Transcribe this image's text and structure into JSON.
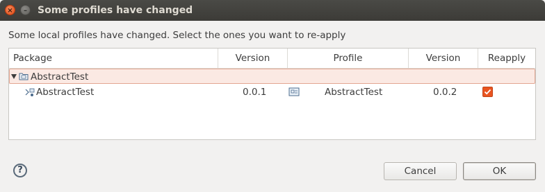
{
  "window": {
    "title": "Some profiles have changed",
    "close_glyph": "×",
    "min_glyph": "–"
  },
  "message": "Some local profiles have changed. Select the ones you want to re-apply",
  "table": {
    "columns": [
      "Package",
      "Version",
      "Profile",
      "Version",
      "Reapply"
    ],
    "group": {
      "label": "AbstractTest",
      "expanded": true,
      "icon": "folder-icon"
    },
    "rows": [
      {
        "package": "AbstractTest",
        "version": "0.0.1",
        "profile": "AbstractTest",
        "profile_version": "0.0.2",
        "reapply": true,
        "package_icon": "package-icon",
        "profile_icon": "profile-icon"
      }
    ]
  },
  "footer": {
    "help_glyph": "?",
    "cancel_label": "Cancel",
    "ok_label": "OK"
  },
  "colors": {
    "accent": "#e95420",
    "selection_bg": "#fbe9e3",
    "selection_border": "#e3a692"
  }
}
